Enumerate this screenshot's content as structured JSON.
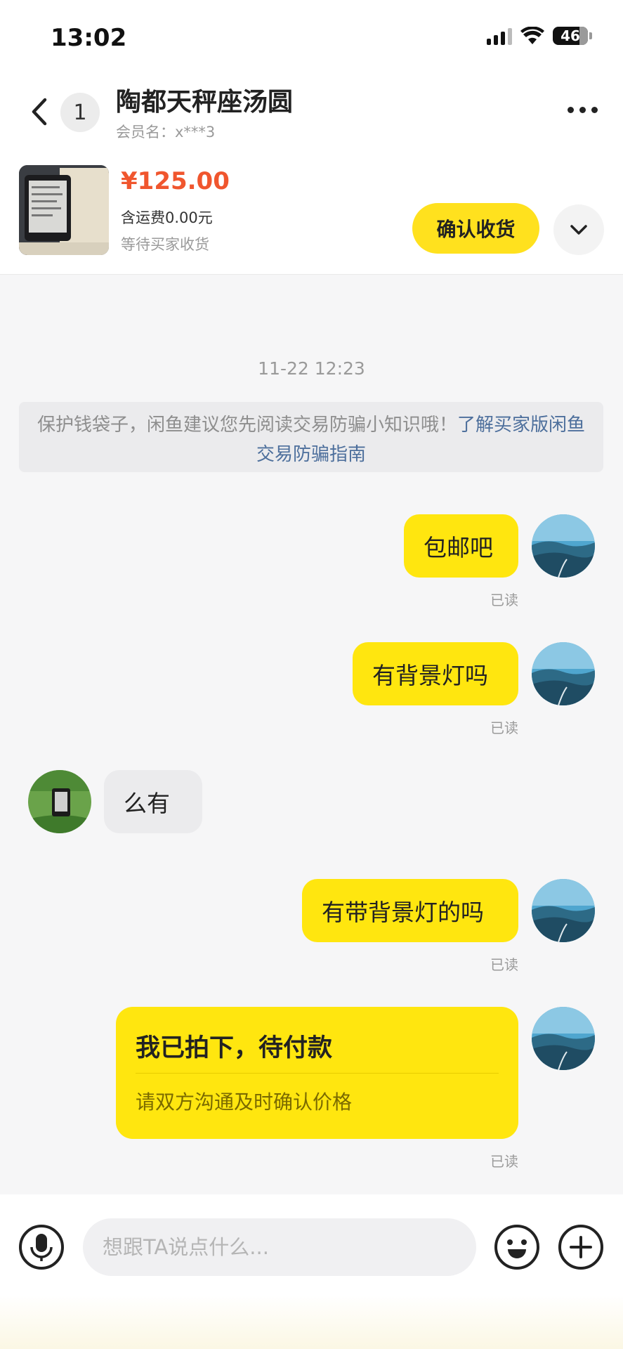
{
  "status_bar": {
    "time": "13:02",
    "battery": "46"
  },
  "header": {
    "unread_count": "1",
    "seller_name": "陶都天秤座汤圆",
    "member_label": "会员名：x***3"
  },
  "product": {
    "price": "¥125.00",
    "shipping": "含运费0.00元",
    "status": "等待买家收货",
    "confirm_label": "确认收货"
  },
  "chat": {
    "timestamp": "11-22 12:23",
    "notice_text": "保护钱袋子，闲鱼建议您先阅读交易防骗小知识哦！",
    "notice_link": "了解买家版闲鱼交易防骗指南",
    "messages": [
      {
        "from": "me",
        "text": "包邮吧",
        "read": "已读"
      },
      {
        "from": "me",
        "text": "有背景灯吗",
        "read": "已读"
      },
      {
        "from": "seller",
        "text": "么有"
      },
      {
        "from": "me",
        "text": "有带背景灯的吗",
        "read": "已读"
      }
    ],
    "order_card": {
      "title": "我已拍下，待付款",
      "subtitle": "请双方沟通及时确认价格",
      "read": "已读"
    }
  },
  "input": {
    "placeholder": "想跟TA说点什么..."
  },
  "colors": {
    "accent_yellow": "#ffe60f",
    "price_orange": "#f0562e",
    "link_blue": "#4d6f9c"
  }
}
